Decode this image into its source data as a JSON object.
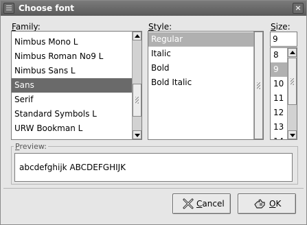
{
  "window": {
    "title": "Choose font",
    "close_glyph": "×"
  },
  "family": {
    "label_ul": "F",
    "label_rest": "amily:",
    "items": [
      "Nimbus Mono L",
      "Nimbus Roman No9 L",
      "Nimbus Sans L",
      "Sans",
      "Serif",
      "Standard Symbols L",
      "URW Bookman L"
    ],
    "selected": "Sans"
  },
  "style": {
    "label_ul": "S",
    "label_rest": "tyle:",
    "items": [
      "Regular",
      "Italic",
      "Bold",
      "Bold Italic"
    ],
    "selected": "Regular"
  },
  "size": {
    "label_ul": "S",
    "label_rest": "ize:",
    "value": "9",
    "items": [
      "8",
      "9",
      "10",
      "11",
      "12",
      "13",
      "14"
    ],
    "selected": "9"
  },
  "preview": {
    "label_ul": "P",
    "label_rest": "review:",
    "text": "abcdefghijk ABCDEFGHIJK"
  },
  "buttons": {
    "cancel_ul": "C",
    "cancel_rest": "ancel",
    "ok_ul": "O",
    "ok_rest": "K"
  },
  "icons": {
    "window": "font-dialog-icon",
    "close": "close-icon",
    "cancel": "cancel-x-icon",
    "ok": "ok-hand-icon"
  }
}
